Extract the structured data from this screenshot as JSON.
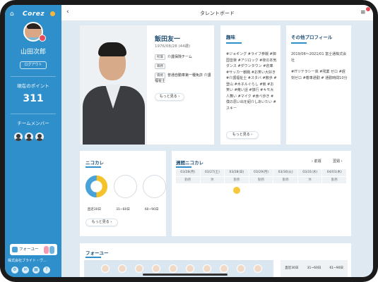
{
  "sidebar": {
    "logo": "Corez",
    "user_name": "山田次郎",
    "logout_label": "ログアウト",
    "points_label": "現在のポイント",
    "points_value": "311",
    "team_label": "チームメンバー",
    "follow_label": "フォーユー",
    "company": "株式会社ブライト・ヴ…"
  },
  "header": {
    "back_icon": "‹",
    "title": "タレントボード",
    "menu_icon": "≡"
  },
  "profile": {
    "name": "飯田友一",
    "birth": "1976/08/28 (44歳)",
    "dept_tag": "所属",
    "dept_value": "介護保険チーム",
    "role_tag": "職務",
    "role_value": "",
    "qual_tag": "資格",
    "qual_value": "普通自動車第一種免許 介護福祉士",
    "more_label": "もっと見る ›"
  },
  "hobby": {
    "title": "趣味",
    "text": "#ジョギング #ライブ参戦 #御国音楽 #アジロック #夜の本気ダンス #ダウンタウン #倉庫 #サッカー観戦 #お笑い大好き #介護福祉士 #スタバ #散歩 #登山 #木子ルぐらし #競 #お笑い #俺い話 #旅行 #キモ大人舞い #マイク #食べ歩き #僕の思い出を紹介しあいたい #スキー",
    "more_label": "もっと見る ›"
  },
  "other": {
    "title": "その他プロフィール",
    "text": "2019/06〜2021/01 富士通株式会社",
    "text2": "#ITリテラシー高 #残業 ゼロ #遅刻ゼロ #着車通勤 # 通勤時間10分"
  },
  "nikokare": {
    "title": "ニコカレ",
    "labels": [
      "直近30日",
      "31~60日",
      "60~90日"
    ],
    "more_label": "もっと見る ›",
    "donut": {
      "yellow": 0.5,
      "blue": 0.5
    }
  },
  "weekly": {
    "title": "週間ニコカレ",
    "prev_label": "‹ 前週",
    "next_label": "翌週 ›",
    "days": [
      "03/28(月)",
      "03/27(土)",
      "03/28(日)",
      "03/29(月)",
      "03/30(火)",
      "03/31(水)",
      "04/01(木)"
    ],
    "sub": [
      "勤務",
      "休",
      "勤務",
      "勤務",
      "勤務",
      "休",
      "勤務"
    ]
  },
  "follow": {
    "title": "フォーユー",
    "labels": [
      "直近30日",
      "31~60日",
      "61~90日"
    ]
  },
  "colors": {
    "accent": "#2e8fcb",
    "donut_yellow": "#f4c22b",
    "donut_blue": "#4aa3d8"
  }
}
